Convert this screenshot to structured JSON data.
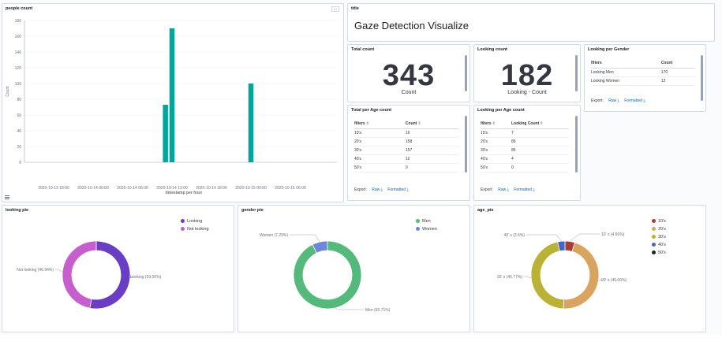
{
  "people_count": {
    "title": "people count",
    "options_label": "•••",
    "ylabel": "Count",
    "xlabel": "timestamp per hour",
    "y_ticks": [
      "0",
      "20",
      "40",
      "60",
      "80",
      "100",
      "120",
      "140",
      "160",
      "180"
    ],
    "x_ticks": [
      "2020-10-13 18:00",
      "2020-10-14 00:00",
      "2020-10-14 06:00",
      "2020-10-14 12:00",
      "2020-10-14 18:00",
      "2020-10-15 00:00",
      "2020-10-15 06:00"
    ],
    "color": "#00a69b",
    "chart_data": {
      "type": "bar",
      "x": [
        "2020-10-14 11:00",
        "2020-10-14 12:00",
        "2020-10-15 00:00"
      ],
      "values": [
        73,
        170,
        100
      ],
      "ylim": [
        0,
        180
      ],
      "xlabel": "timestamp per hour",
      "ylabel": "Count"
    }
  },
  "title_panel": {
    "title": "title",
    "text": "Gaze Detection Visualize"
  },
  "total_count": {
    "title": "Total count",
    "value": "343",
    "label": "Count"
  },
  "looking_count": {
    "title": "Looking count",
    "value": "182",
    "label": "Looking - Count"
  },
  "looking_gender": {
    "title": "Looking per Gender",
    "headers": [
      "filters",
      "Count"
    ],
    "rows": [
      [
        "Looking Men",
        "170"
      ],
      [
        "Looking Women",
        "12"
      ]
    ],
    "export_label": "Export:",
    "raw": "Raw",
    "formatted": "Formatted"
  },
  "total_age": {
    "title": "Total per Age count",
    "headers": [
      "filters",
      "Count"
    ],
    "rows": [
      [
        "10's",
        "16"
      ],
      [
        "20's",
        "158"
      ],
      [
        "30's",
        "157"
      ],
      [
        "40's",
        "12"
      ],
      [
        "50's",
        "0"
      ]
    ],
    "export_label": "Export:",
    "raw": "Raw",
    "formatted": "Formatted"
  },
  "looking_age": {
    "title": "Looking per Age count",
    "headers": [
      "filters",
      "Looking Count"
    ],
    "rows": [
      [
        "10's",
        "7"
      ],
      [
        "20's",
        "86"
      ],
      [
        "30's",
        "85"
      ],
      [
        "40's",
        "4"
      ],
      [
        "50's",
        "0"
      ]
    ],
    "export_label": "Export:",
    "raw": "Raw",
    "formatted": "Formatted"
  },
  "looking_pie": {
    "title": "looking pie",
    "legend": [
      {
        "label": "Looking",
        "color": "#6a3ec2"
      },
      {
        "label": "Not looking",
        "color": "#c75ecd"
      }
    ],
    "slices": [
      {
        "label": "Looking (53.06%)",
        "value": 53.06,
        "color": "#6a3ec2"
      },
      {
        "label": "Not looking (46.94%)",
        "value": 46.94,
        "color": "#c75ecd"
      }
    ]
  },
  "gender_pie": {
    "title": "gender pie",
    "legend": [
      {
        "label": "Men",
        "color": "#54b97a"
      },
      {
        "label": "Women",
        "color": "#6f87d8"
      }
    ],
    "slices": [
      {
        "label": "Men (92.71%)",
        "value": 92.71,
        "color": "#54b97a"
      },
      {
        "label": "Women (7.29%)",
        "value": 7.29,
        "color": "#6f87d8"
      }
    ]
  },
  "age_pie": {
    "title": "age_pie",
    "legend": [
      {
        "label": "10's",
        "color": "#aa3b35"
      },
      {
        "label": "20's",
        "color": "#d9a460"
      },
      {
        "label": "30's",
        "color": "#b9b236"
      },
      {
        "label": "40's",
        "color": "#4565c4"
      },
      {
        "label": "50's",
        "color": "#222222"
      }
    ],
    "slices": [
      {
        "label": "10' s (4.66%)",
        "value": 4.66,
        "color": "#aa3b35"
      },
      {
        "label": "20' s (46.06%)",
        "value": 46.06,
        "color": "#d9a460"
      },
      {
        "label": "30' s (45.77%)",
        "value": 45.77,
        "color": "#b9b236"
      },
      {
        "label": "40' s (3.5%)",
        "value": 3.5,
        "color": "#4565c4"
      }
    ]
  }
}
